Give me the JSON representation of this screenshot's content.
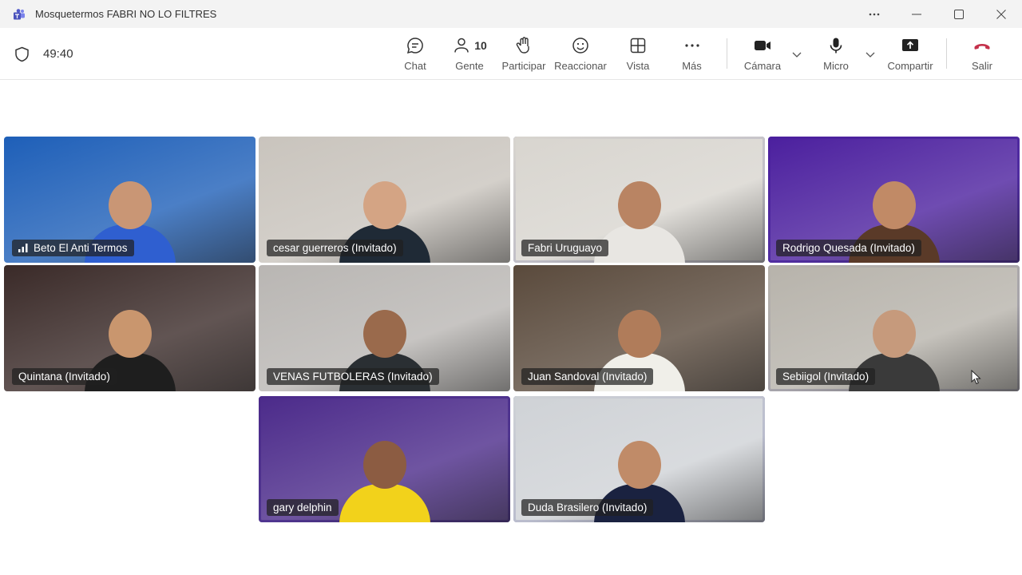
{
  "window": {
    "title": "Mosquetermos FABRI NO LO FILTRES"
  },
  "toolbar": {
    "timer": "49:40",
    "chat_label": "Chat",
    "people_label": "Gente",
    "people_count": "10",
    "raise_label": "Participar",
    "react_label": "Reaccionar",
    "view_label": "Vista",
    "more_label": "Más",
    "camera_label": "Cámara",
    "mic_label": "Micro",
    "share_label": "Compartir",
    "leave_label": "Salir",
    "leave_color": "#c4314b"
  },
  "participants": [
    {
      "name": "Beto El Anti Termos",
      "active": false,
      "bg": "#1e5fb8"
    },
    {
      "name": "cesar guerreros (Invitado)",
      "active": false,
      "bg": "#c9c4bd"
    },
    {
      "name": "Fabri Uruguayo",
      "active": true,
      "bg": "#d8d5cf"
    },
    {
      "name": "Rodrigo Quesada (Invitado)",
      "active": true,
      "bg": "#4b1f9e"
    },
    {
      "name": "Quintana (Invitado)",
      "active": false,
      "bg": "#3a2a28"
    },
    {
      "name": "VENAS FUTBOLERAS (Invitado)",
      "active": false,
      "bg": "#b9b6b3"
    },
    {
      "name": "Juan Sandoval (Invitado)",
      "active": false,
      "bg": "#5a4a3c"
    },
    {
      "name": "Sebiigol (Invitado)",
      "active": true,
      "bg": "#b7b3ab"
    },
    {
      "name": "gary delphin",
      "active": true,
      "bg": "#4b2a8a"
    },
    {
      "name": "Duda Brasilero (Invitado)",
      "active": true,
      "bg": "#cfd2d6"
    }
  ],
  "accent_color": "#6264a7"
}
